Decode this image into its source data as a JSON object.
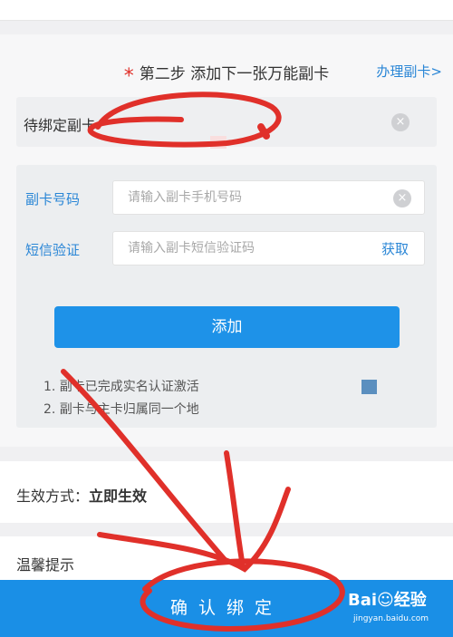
{
  "step": {
    "star": "*",
    "title": "第二步 添加下一张万能副卡",
    "link": "办理副卡>"
  },
  "pending": {
    "label": "待绑定副卡",
    "clear_icon": "×"
  },
  "form": {
    "card_number_label": "副卡号码",
    "card_number_placeholder": "请输入副卡手机号码",
    "sms_label": "短信验证",
    "sms_placeholder": "请输入副卡短信验证码",
    "get_code": "获取",
    "add_button": "添加",
    "notes": [
      "1. 副卡已完成实名认证激活",
      "2. 副卡与主卡归属同一个地"
    ]
  },
  "effect": {
    "label": "生效方式：",
    "value": "立即生效"
  },
  "tips": {
    "label": "温馨提示"
  },
  "confirm": {
    "label": "确认绑定"
  },
  "watermark": {
    "brand": "Bai☺经验",
    "url": "jingyan.baidu.com"
  },
  "colors": {
    "accent": "#1a8fe6",
    "link": "#2a86d6",
    "annotation": "#e0302a"
  }
}
